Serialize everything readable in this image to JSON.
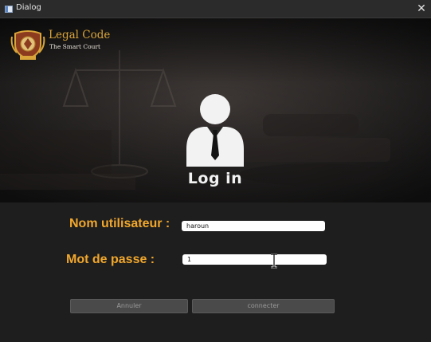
{
  "window": {
    "title": "Dialog",
    "close_glyph": "✕"
  },
  "brand": {
    "name": "Legal Code",
    "tagline": "The Smart Court"
  },
  "header": {
    "title": "Log in"
  },
  "form": {
    "username_label": "Nom utilisateur :",
    "username_value": "haroun",
    "password_label": "Mot de passe :",
    "password_value": "1"
  },
  "buttons": {
    "cancel_label": "Annuler",
    "connect_label": "connecter"
  },
  "colors": {
    "accent": "#f1a72c",
    "brand": "#d9a53a",
    "background": "#1e1e1e",
    "button": "#4a4a4a"
  },
  "icons": {
    "app": "window-icon",
    "close": "close-icon",
    "user": "user-tie-icon",
    "seal": "court-seal-logo",
    "cursor": "text-cursor-icon"
  }
}
